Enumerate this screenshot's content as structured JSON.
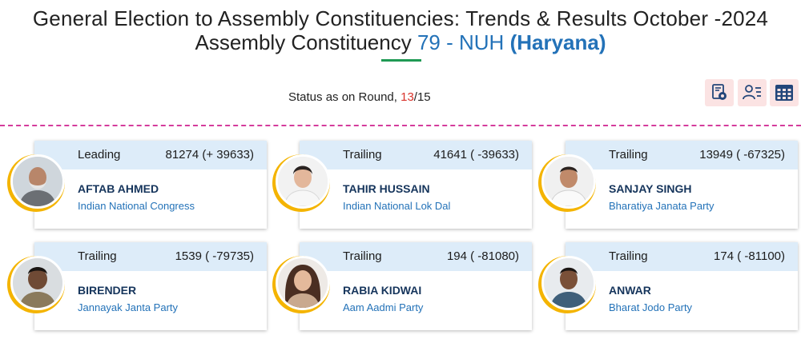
{
  "header": {
    "title_line1": "General Election to Assembly Constituencies: Trends & Results October -2024",
    "title_prefix": "Assembly Constituency",
    "constituency": "79 - NUH",
    "state": "(Haryana)"
  },
  "status": {
    "label": "Status as on Round,",
    "current_round": "13",
    "separator": "/",
    "total_rounds": "15"
  },
  "toolbar": {
    "icons": [
      "constituency-map-icon",
      "candidate-list-icon",
      "table-view-icon"
    ],
    "accent_color": "#23467a"
  },
  "colors": {
    "card_header_bg": "#ddecf9",
    "party_text": "#2372b8",
    "name_text": "#16355c",
    "ring": "#f4b400",
    "divider": "#d43c9c",
    "round_highlight": "#d9332b"
  },
  "candidates": [
    {
      "status": "Leading",
      "votes": "81274 (+ 39633)",
      "name": "AFTAB AHMED",
      "party": "Indian National Congress"
    },
    {
      "status": "Trailing",
      "votes": "41641 ( -39633)",
      "name": "TAHIR HUSSAIN",
      "party": "Indian National Lok Dal"
    },
    {
      "status": "Trailing",
      "votes": "13949 ( -67325)",
      "name": "SANJAY SINGH",
      "party": "Bharatiya Janata Party"
    },
    {
      "status": "Trailing",
      "votes": "1539 ( -79735)",
      "name": "BIRENDER",
      "party": "Jannayak Janta Party"
    },
    {
      "status": "Trailing",
      "votes": "194 ( -81080)",
      "name": "RABIA KIDWAI",
      "party": "Aam Aadmi Party"
    },
    {
      "status": "Trailing",
      "votes": "174 ( -81100)",
      "name": "ANWAR",
      "party": "Bharat Jodo Party"
    }
  ]
}
